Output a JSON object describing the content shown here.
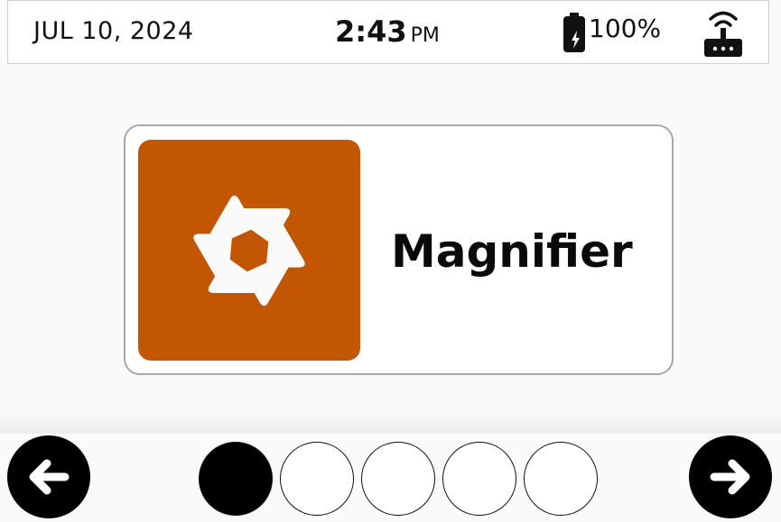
{
  "status_bar": {
    "date": "JUL 10, 2024",
    "time": "2:43",
    "ampm": "PM",
    "battery_percent": "100%",
    "battery_icon": "battery-charging-icon",
    "network_icon": "wifi-router-icon"
  },
  "app": {
    "label": "Magnifier",
    "icon": "aperture-icon",
    "icon_tile_color": "#c25602"
  },
  "pagination": {
    "total_pages": 5,
    "current_page": 1
  },
  "navigation": {
    "prev_icon": "arrow-left-icon",
    "next_icon": "arrow-right-icon"
  }
}
